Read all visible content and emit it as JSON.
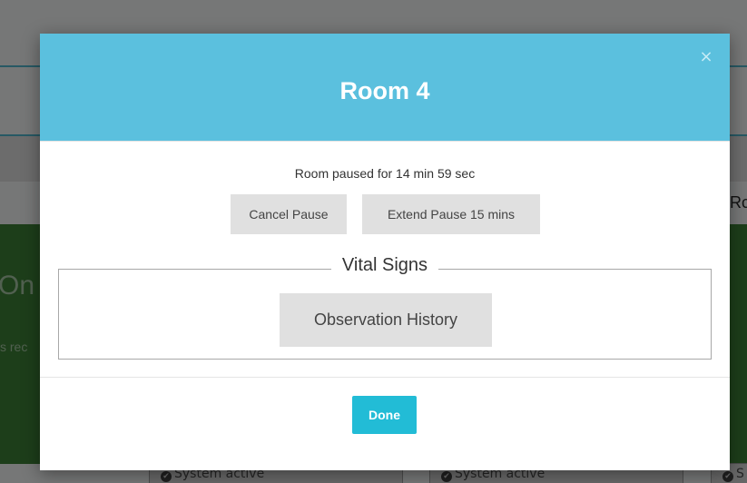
{
  "background": {
    "fragment_left_title": "On",
    "fragment_left_text": "s rec",
    "fragment_right_title": "Rc",
    "footer_status_1": "System active",
    "footer_status_2": "System active",
    "footer_status_3": "S",
    "check_glyph": "✔",
    "colors": {
      "accent_line": "#4fb2c9",
      "card_green": "#3a7d35"
    }
  },
  "modal": {
    "title": "Room 4",
    "close_glyph": "×",
    "pause_status": "Room paused for 14 min 59 sec",
    "cancel_pause_label": "Cancel Pause",
    "extend_pause_label": "Extend Pause 15 mins",
    "vital_signs_legend": "Vital Signs",
    "observation_history_label": "Observation History",
    "done_label": "Done",
    "colors": {
      "header": "#5bc0de",
      "done_button": "#22bcd6",
      "secondary_button": "#e0e0e0"
    }
  }
}
